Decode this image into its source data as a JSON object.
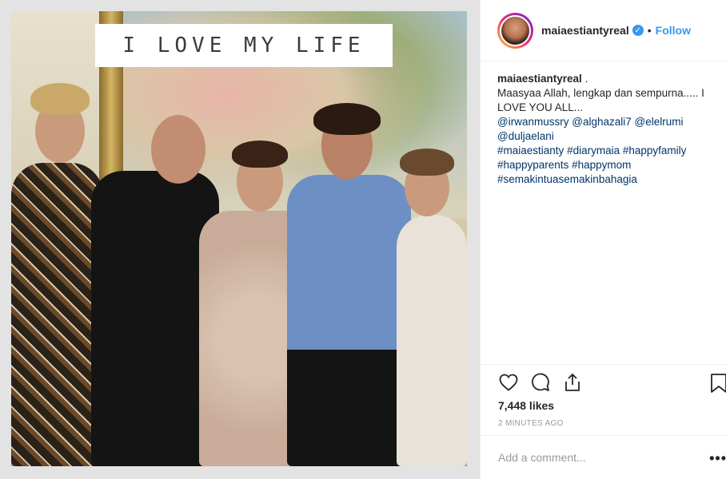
{
  "photo": {
    "banner_text": "I LOVE MY LIFE"
  },
  "header": {
    "username": "maiaestiantyreal",
    "separator": "•",
    "follow_label": "Follow"
  },
  "caption": {
    "username": "maiaestiantyreal",
    "text": "Maasyaa Allah, lengkap dan sempurna..... I LOVE YOU ALL...",
    "mentions": [
      "@irwanmussry",
      "@alghazali7",
      "@elelrumi",
      "@duljaelani"
    ],
    "hashtags": [
      "#maiaestianty",
      "#diarymaia",
      "#happyfamily",
      "#happyparents",
      "#happymom",
      "#semakintuasemakinbahagia"
    ]
  },
  "actions": {
    "like_icon": "heart-icon",
    "comment_icon": "comment-icon",
    "share_icon": "share-icon",
    "save_icon": "bookmark-icon"
  },
  "likes": "7,448 likes",
  "timestamp": "2 MINUTES AGO",
  "comment": {
    "placeholder": "Add a comment...",
    "more_label": "•••"
  },
  "colors": {
    "accent": "#3897f0",
    "link": "#003569",
    "border": "#efefef"
  }
}
